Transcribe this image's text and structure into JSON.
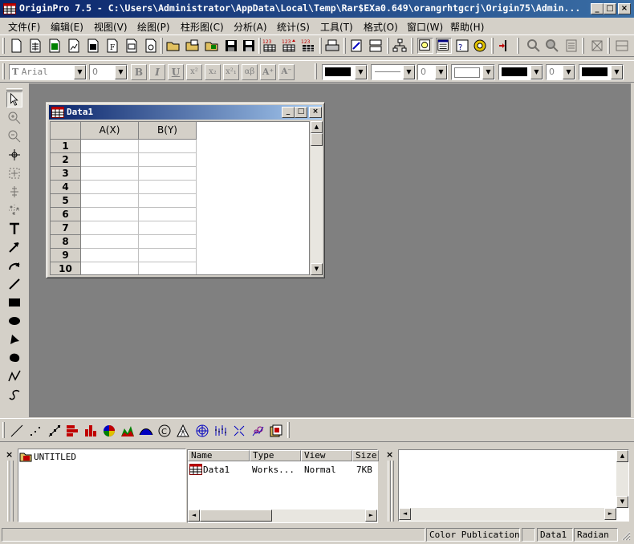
{
  "window": {
    "title": "OriginPro 7.5 - C:\\Users\\Administrator\\AppData\\Local\\Temp\\Rar$EXa0.649\\orangrhtgcrj\\Origin75\\Admin...",
    "minimize": "_",
    "maximize": "□",
    "close": "×"
  },
  "menu": [
    "文件(F)",
    "编辑(E)",
    "视图(V)",
    "绘图(P)",
    "柱形图(C)",
    "分析(A)",
    "统计(S)",
    "工具(T)",
    "格式(O)",
    "窗口(W)",
    "帮助(H)"
  ],
  "format_toolbar": {
    "font_name": "Arial",
    "font_size": "0",
    "bold": "B",
    "italic": "I",
    "underline": "U",
    "superscript": "x²",
    "subscript": "x₂",
    "supsub": "x²₁",
    "greek": "αβ",
    "increase_font": "A⁺",
    "decrease_font": "A⁻",
    "line_width": "0",
    "pattern_value": "0"
  },
  "worksheet": {
    "title": "Data1",
    "columns": [
      "A(X)",
      "B(Y)"
    ],
    "rows": [
      "1",
      "2",
      "3",
      "4",
      "5",
      "6",
      "7",
      "8",
      "9",
      "10"
    ]
  },
  "project_explorer": {
    "folder": "UNTITLED",
    "headers": [
      "Name",
      "Type",
      "View",
      "Size"
    ],
    "items": [
      {
        "name": "Data1",
        "type": "Works...",
        "view": "Normal",
        "size": "7KB"
      }
    ]
  },
  "statusbar": {
    "theme": "Color Publication",
    "active_window": "Data1",
    "angle_unit": "Radian"
  },
  "colors": {
    "title_active": "#0a246a",
    "workspace": "#808080",
    "face": "#d4d0c8"
  }
}
